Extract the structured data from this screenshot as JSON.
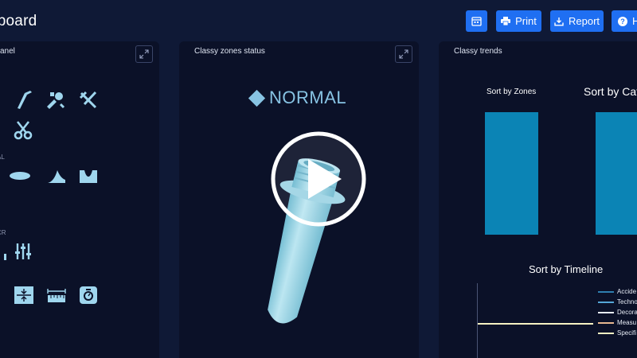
{
  "header": {
    "title": "hboard",
    "buttons": {
      "calendar": {
        "icon": "calendar-icon"
      },
      "print": {
        "label": "Print",
        "icon": "printer-icon"
      },
      "report": {
        "label": "Report",
        "icon": "download-icon"
      },
      "help": {
        "label": "H",
        "icon": "question-icon"
      }
    }
  },
  "panels": {
    "left": {
      "title": "anel",
      "sections": [
        {
          "label": "",
          "icons": [
            "brush-icon",
            "brush-icon",
            "tools-icon",
            "tools-icon",
            "scissors-icon"
          ]
        },
        {
          "label": "AL",
          "icons": [
            "ellipse-icon",
            "fin-icon",
            "bowl-icon"
          ]
        },
        {
          "label": "CR",
          "icons": [
            "sliders-icon"
          ]
        },
        {
          "label": "",
          "icons": [
            "dimension-icon",
            "ruler-icon",
            "scale-icon"
          ]
        }
      ]
    },
    "middle": {
      "title": "Classy zones status",
      "status_label": "NORMAL",
      "status_color": "#87c3e3",
      "product_image": "preform-bottle-image",
      "overlay_icon": "play-icon"
    },
    "right": {
      "title": "Classy trends",
      "charts": {
        "zones": {
          "title": "Sort by Zones"
        },
        "categories": {
          "title": "Sort by Cate"
        },
        "timeline": {
          "title": "Sort by Timeline",
          "legend": [
            {
              "label": "Accide",
              "color": "#2f7fb0"
            },
            {
              "label": "Techno",
              "color": "#55a6d6"
            },
            {
              "label": "Decora",
              "color": "#e6ebf5"
            },
            {
              "label": "Measu",
              "color": "#e8b890"
            },
            {
              "label": "Specifi",
              "color": "#f6f2c2"
            }
          ]
        }
      }
    }
  },
  "colors": {
    "background": "#0f1936",
    "panel": "#0b1128",
    "accent": "#1f6ff2",
    "bar": "#0b84b5"
  }
}
